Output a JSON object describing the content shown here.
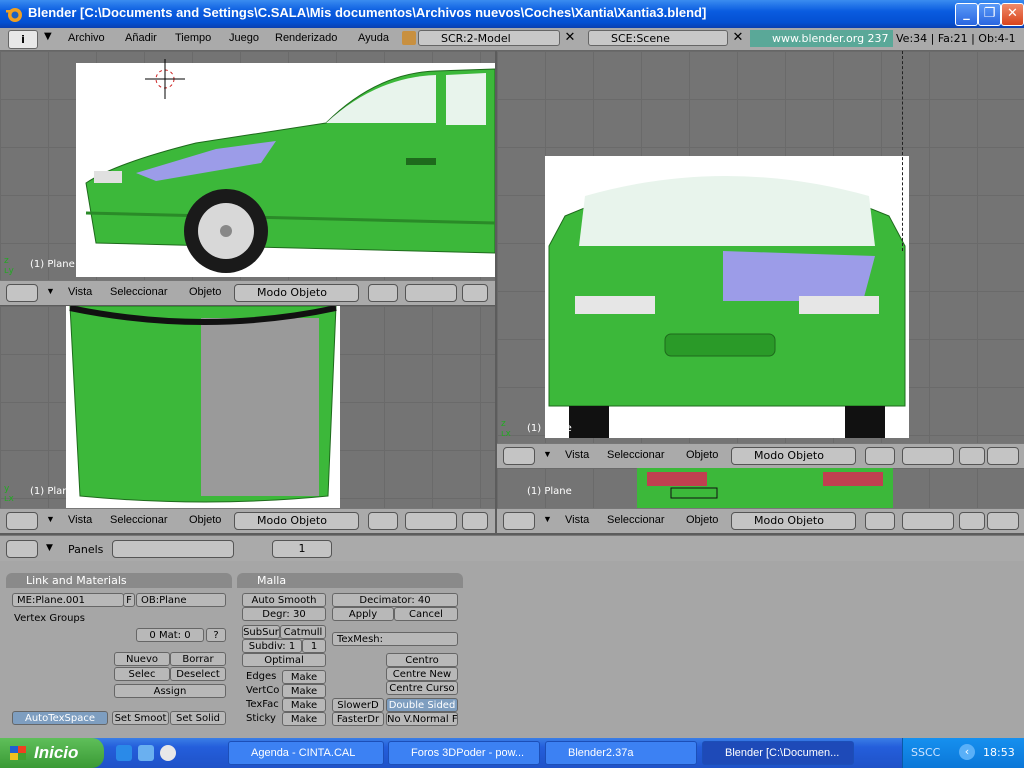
{
  "window": {
    "title": "Blender [C:\\Documents and Settings\\C.SALA\\Mis documentos\\Archivos nuevos\\Coches\\Xantia\\Xantia3.blend]"
  },
  "header": {
    "menus": [
      "Archivo",
      "Añadir",
      "Tiempo",
      "Juego",
      "Renderizado",
      "Ayuda"
    ],
    "screen": "SCR:2-Model",
    "scene": "SCE:Scene",
    "site": "www.blender.org 237",
    "stats": "Ve:34 | Fa:21 | Ob:4-1"
  },
  "viewport": {
    "menus": [
      "Vista",
      "Seleccionar",
      "Objeto"
    ],
    "mode": "Modo Objeto",
    "object_label": "(1) Plane"
  },
  "buttons": {
    "panels_label": "Panels",
    "page": "1",
    "link": {
      "title": "Link and Materials",
      "mesh": "ME:Plane.001",
      "f": "F",
      "ob": "OB:Plane",
      "vgroups": "Vertex Groups",
      "mat": "0 Mat: 0",
      "q": "?",
      "nuevo": "Nuevo",
      "borrar": "Borrar",
      "selec": "Selec",
      "deselect": "Deselect",
      "assign": "Assign",
      "autotex": "AutoTexSpace",
      "setsmooth": "Set Smoot",
      "setsolid": "Set Solid"
    },
    "malla": {
      "title": "Malla",
      "autosmooth": "Auto Smooth",
      "degr": "Degr: 30",
      "decimator": "Decimator: 40",
      "apply": "Apply",
      "cancel": "Cancel",
      "subsurf": "SubSur",
      "catmull": "Catmull",
      "subdiv": "Subdiv: 1",
      "subdiv2": "1",
      "optimal": "Optimal",
      "texmesh": "TexMesh:",
      "centro": "Centro",
      "centrenew": "Centre New",
      "centrecurso": "Centre Curso",
      "edges": "Edges",
      "vertco": "VertCo",
      "texfac": "TexFac",
      "sticky": "Sticky",
      "make": "Make",
      "slower": "SlowerD",
      "faster": "FasterDr",
      "doublesided": "Double Sided",
      "novnormal": "No V.Normal F"
    }
  },
  "taskbar": {
    "start": "Inicio",
    "tasks": [
      "Agenda - CINTA.CAL",
      "Foros 3DPoder - pow...",
      "Blender2.37a",
      "Blender [C:\\Documen..."
    ],
    "lang": "SSCC",
    "clock": "18:53"
  },
  "colors": {
    "car_green": "#3cb83a",
    "hood_purple": "#9c9ce8",
    "blender_gray": "#aaaaaa"
  }
}
